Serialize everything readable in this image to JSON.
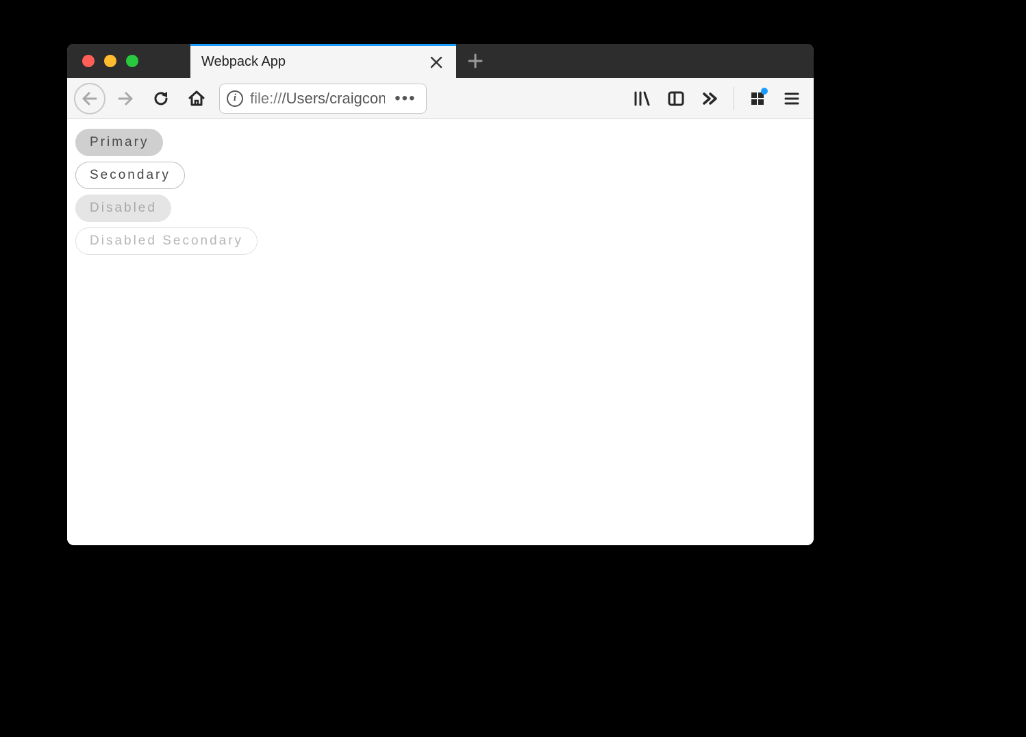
{
  "tab": {
    "title": "Webpack App"
  },
  "address": {
    "scheme": "file://",
    "path": "/Users/craigcondon/Developer/pub"
  },
  "buttons": {
    "primary": "Primary",
    "secondary": "Secondary",
    "disabled": "Disabled",
    "disabled_secondary": "Disabled Secondary"
  }
}
